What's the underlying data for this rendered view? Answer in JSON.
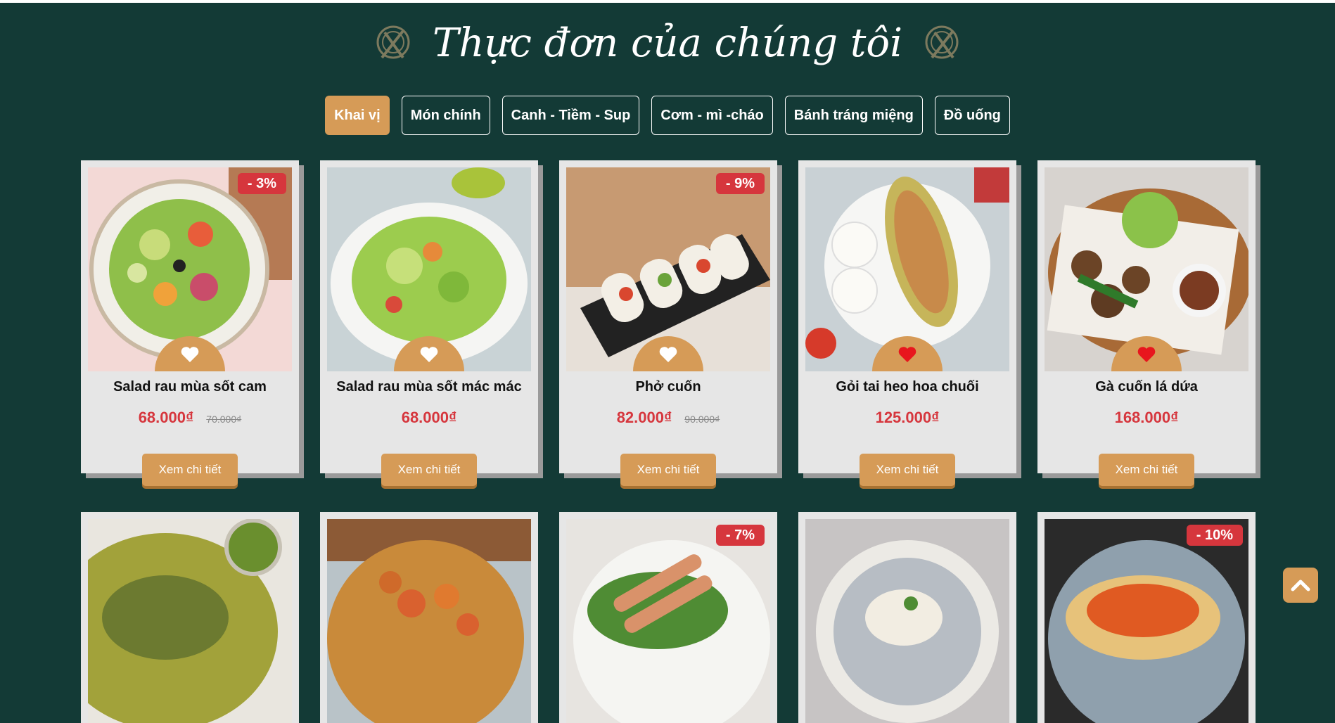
{
  "header": {
    "title": "Thực đơn của chúng tôi",
    "left_icon": "plate-fork-knife-icon",
    "right_icon": "plate-fork-knife-icon"
  },
  "tabs": [
    {
      "label": "Khai vị",
      "active": true
    },
    {
      "label": "Món chính",
      "active": false
    },
    {
      "label": "Canh - Tiềm - Sup",
      "active": false
    },
    {
      "label": "Cơm - mì -cháo",
      "active": false
    },
    {
      "label": "Bánh tráng miệng",
      "active": false
    },
    {
      "label": "Đồ uống",
      "active": false
    }
  ],
  "menu_items": [
    {
      "name": "Salad rau mùa sốt cam",
      "price": "68.000₫",
      "old_price": "70.000₫",
      "discount": "- 3%",
      "liked": false,
      "button": "Xem chi tiết"
    },
    {
      "name": "Salad rau mùa sốt mác mác",
      "price": "68.000₫",
      "old_price": "",
      "discount": "",
      "liked": false,
      "button": "Xem chi tiết"
    },
    {
      "name": "Phở cuốn",
      "price": "82.000₫",
      "old_price": "90.000₫",
      "discount": "- 9%",
      "liked": false,
      "button": "Xem chi tiết"
    },
    {
      "name": "Gỏi tai heo hoa chuối",
      "price": "125.000₫",
      "old_price": "",
      "discount": "",
      "liked": true,
      "button": "Xem chi tiết"
    },
    {
      "name": "Gà cuốn lá dứa",
      "price": "168.000₫",
      "old_price": "",
      "discount": "",
      "liked": true,
      "button": "Xem chi tiết"
    }
  ],
  "menu_items_row2": [
    {
      "discount": ""
    },
    {
      "discount": ""
    },
    {
      "discount": "- 7%"
    },
    {
      "discount": ""
    },
    {
      "discount": "- 10%"
    }
  ],
  "scroll_top_icon": "chevron-up-icon",
  "colors": {
    "background": "#133a36",
    "accent": "#d69b57",
    "price": "#d6363d",
    "badge": "#d6363d",
    "card": "#e6e6e6"
  }
}
